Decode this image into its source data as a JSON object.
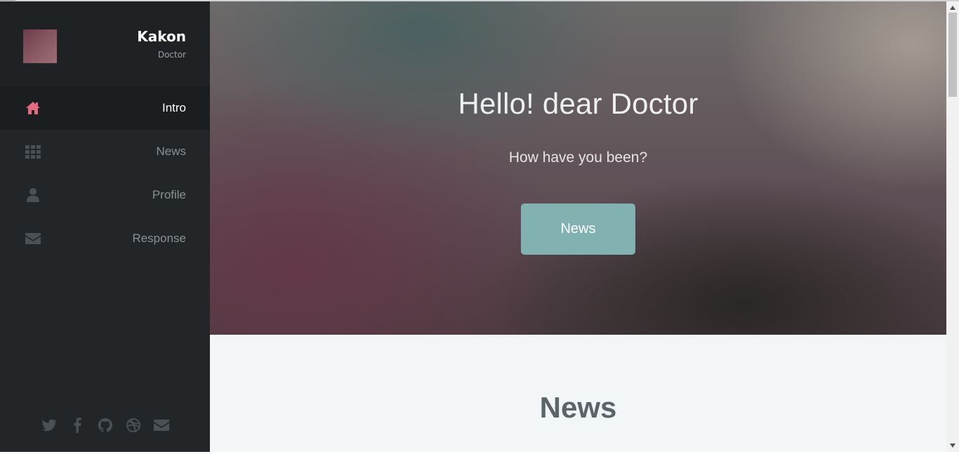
{
  "sidebar": {
    "profile": {
      "name": "Kakon",
      "role": "Doctor"
    },
    "nav": [
      {
        "label": "Intro",
        "icon": "home-icon",
        "active": true
      },
      {
        "label": "News",
        "icon": "grid-icon",
        "active": false
      },
      {
        "label": "Profile",
        "icon": "user-icon",
        "active": false
      },
      {
        "label": "Response",
        "icon": "envelope-icon",
        "active": false
      }
    ],
    "social": [
      "twitter-icon",
      "facebook-icon",
      "github-icon",
      "dribbble-icon",
      "envelope-icon"
    ]
  },
  "hero": {
    "title": "Hello! dear Doctor",
    "subtitle": "How have you been?",
    "button_label": "News"
  },
  "news_section": {
    "heading": "News"
  },
  "colors": {
    "sidebar_bg": "#222629",
    "active_icon": "#e46a7e",
    "nav_icon": "#4b5055",
    "button_bg": "#81b1b0"
  }
}
